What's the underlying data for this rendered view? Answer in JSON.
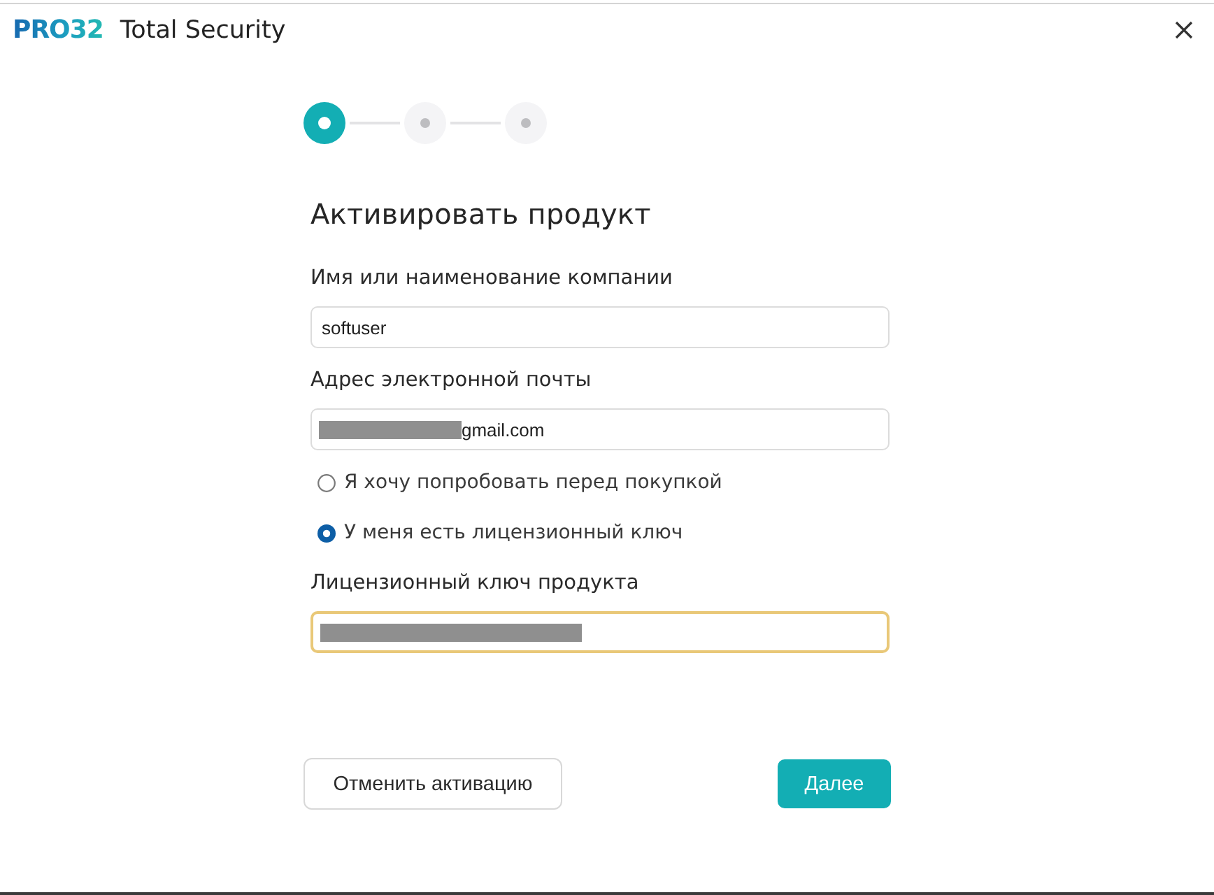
{
  "window": {
    "logo": "PRO32",
    "title": "Total Security"
  },
  "stepper": {
    "steps": [
      {
        "selected": true
      },
      {
        "selected": false
      },
      {
        "selected": false
      }
    ]
  },
  "form": {
    "heading": "Активировать продукт",
    "company": {
      "label": "Имя или наименование компании",
      "value": "softuser"
    },
    "email": {
      "label": "Адрес электронной почты",
      "value": "gmail.com",
      "redacted": true
    },
    "plan_options": [
      {
        "label": "Я хочу попробовать перед покупкой",
        "selected": false
      },
      {
        "label": "У меня есть лицензионный ключ",
        "selected": true
      }
    ],
    "license_key": {
      "label": "Лицензионный ключ продукта",
      "redacted": true,
      "focused": true
    }
  },
  "buttons": {
    "cancel": "Отменить активацию",
    "next": "Далее"
  }
}
